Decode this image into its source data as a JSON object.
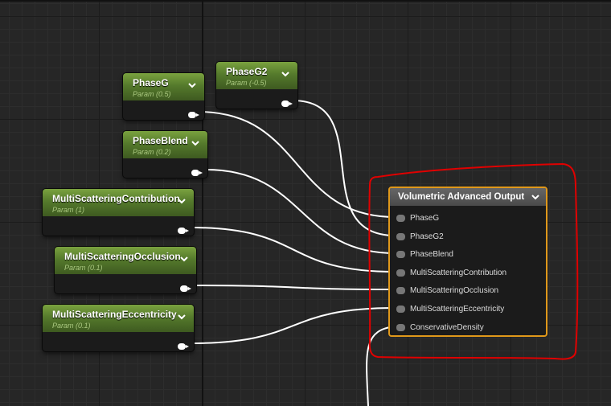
{
  "nodes": [
    {
      "title": "PhaseG",
      "subtitle": "Param (0.5)"
    },
    {
      "title": "PhaseG2",
      "subtitle": "Param (-0.5)"
    },
    {
      "title": "PhaseBlend",
      "subtitle": "Param (0.2)"
    },
    {
      "title": "MultiScatteringContribution",
      "subtitle": "Param (1)"
    },
    {
      "title": "MultiScatteringOcclusion",
      "subtitle": "Param (0.1)"
    },
    {
      "title": "MultiScatteringEccentricity",
      "subtitle": "Param (0.1)"
    }
  ],
  "output_node": {
    "title": "Volumetric Advanced Output",
    "inputs": [
      "PhaseG",
      "PhaseG2",
      "PhaseBlend",
      "MultiScatteringContribution",
      "MultiScatteringOcclusion",
      "MultiScatteringEccentricity",
      "ConservativeDensity"
    ]
  },
  "colors": {
    "grid_bg": "#262626",
    "param_header": "#557a2c",
    "output_border": "#e0981a",
    "highlight": "#e00000",
    "wire": "#ffffff"
  },
  "icons": {
    "collapse": "chevron-down-icon",
    "output_pin": "exec-pin-icon",
    "input_pin": "input-pin-icon"
  }
}
